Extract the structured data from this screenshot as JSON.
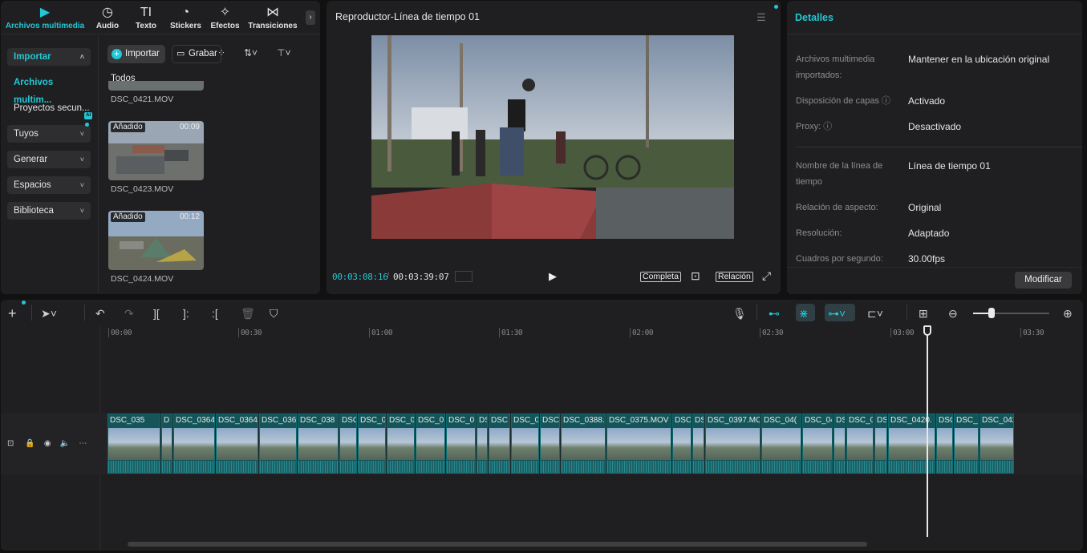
{
  "media_panel": {
    "tabs": [
      {
        "label": "Archivos multimedia",
        "icon": "media-icon",
        "glyph": "▶"
      },
      {
        "label": "Audio",
        "icon": "audio-icon",
        "glyph": "♫"
      },
      {
        "label": "Texto",
        "icon": "text-icon",
        "glyph": "TI"
      },
      {
        "label": "Stickers",
        "icon": "sticker-icon",
        "glyph": "◔"
      },
      {
        "label": "Efectos",
        "icon": "effects-icon",
        "glyph": "✧"
      },
      {
        "label": "Transiciones",
        "icon": "transitions-icon",
        "glyph": "⋈"
      }
    ],
    "sidebar": {
      "import": "Importar",
      "items": [
        "Archivos multim...",
        "Proyectos secun..."
      ],
      "groups": [
        "Tuyos",
        "Generar",
        "Espacios",
        "Biblioteca"
      ],
      "ai_badge": "AI"
    },
    "import_button": "Importar",
    "record_button": "Grabar",
    "filter_all": "Todos",
    "files": [
      {
        "name": "DSC_0421.MOV",
        "badge": "",
        "duration": ""
      },
      {
        "name": "DSC_0423.MOV",
        "badge": "Añadido",
        "duration": "00:09"
      },
      {
        "name": "DSC_0424.MOV",
        "badge": "Añadido",
        "duration": "00:12"
      }
    ]
  },
  "player": {
    "title": "Reproductor-Línea de tiempo 01",
    "current_time": "00:03:08:16",
    "separator": "/",
    "total_time": "00:03:39:07",
    "full_label": "Completa",
    "ratio_label": "Relación"
  },
  "details": {
    "title": "Detalles",
    "rows": [
      {
        "label": "Archivos multimedia importados:",
        "value": "Mantener en la ubicación original"
      },
      {
        "label": "Disposición de capas ⓘ",
        "value": "Activado"
      },
      {
        "label": "Proxy: ⓘ",
        "value": "Desactivado"
      },
      {
        "label": "Nombre de la línea de tiempo",
        "value": "Línea de tiempo 01"
      },
      {
        "label": "Relación de aspecto:",
        "value": "Original"
      },
      {
        "label": "Resolución:",
        "value": "Adaptado"
      },
      {
        "label": "Cuadros por segundo:",
        "value": "30.00fps"
      }
    ],
    "modify_button": "Modificar"
  },
  "timeline": {
    "ruler_labels": [
      "00:00",
      "00:30",
      "01:00",
      "01:30",
      "02:00",
      "02:30",
      "03:00",
      "03:30"
    ],
    "clips": [
      "DSC_035",
      "D",
      "DSC_0364",
      "DSC_0364",
      "DSC_036",
      "DSC_038",
      "DSC",
      "DSC_0",
      "DSC_0",
      "DSC_0",
      "DSC_0",
      "DS",
      "DSC",
      "DSC_0",
      "DSC",
      "DSC_0388.",
      "DSC_0375.MOV",
      "DSC_0",
      "DS",
      "DSC_0397.MO",
      "DSC_04(",
      "DSC_04",
      "DS",
      "DSC_0",
      "DS",
      "DSC_0420.",
      "DSC",
      "DSC_",
      "DSC_042"
    ]
  },
  "colors": {
    "accent": "#21c8d6",
    "panel": "#1f1f21",
    "clip": "#14555a"
  }
}
